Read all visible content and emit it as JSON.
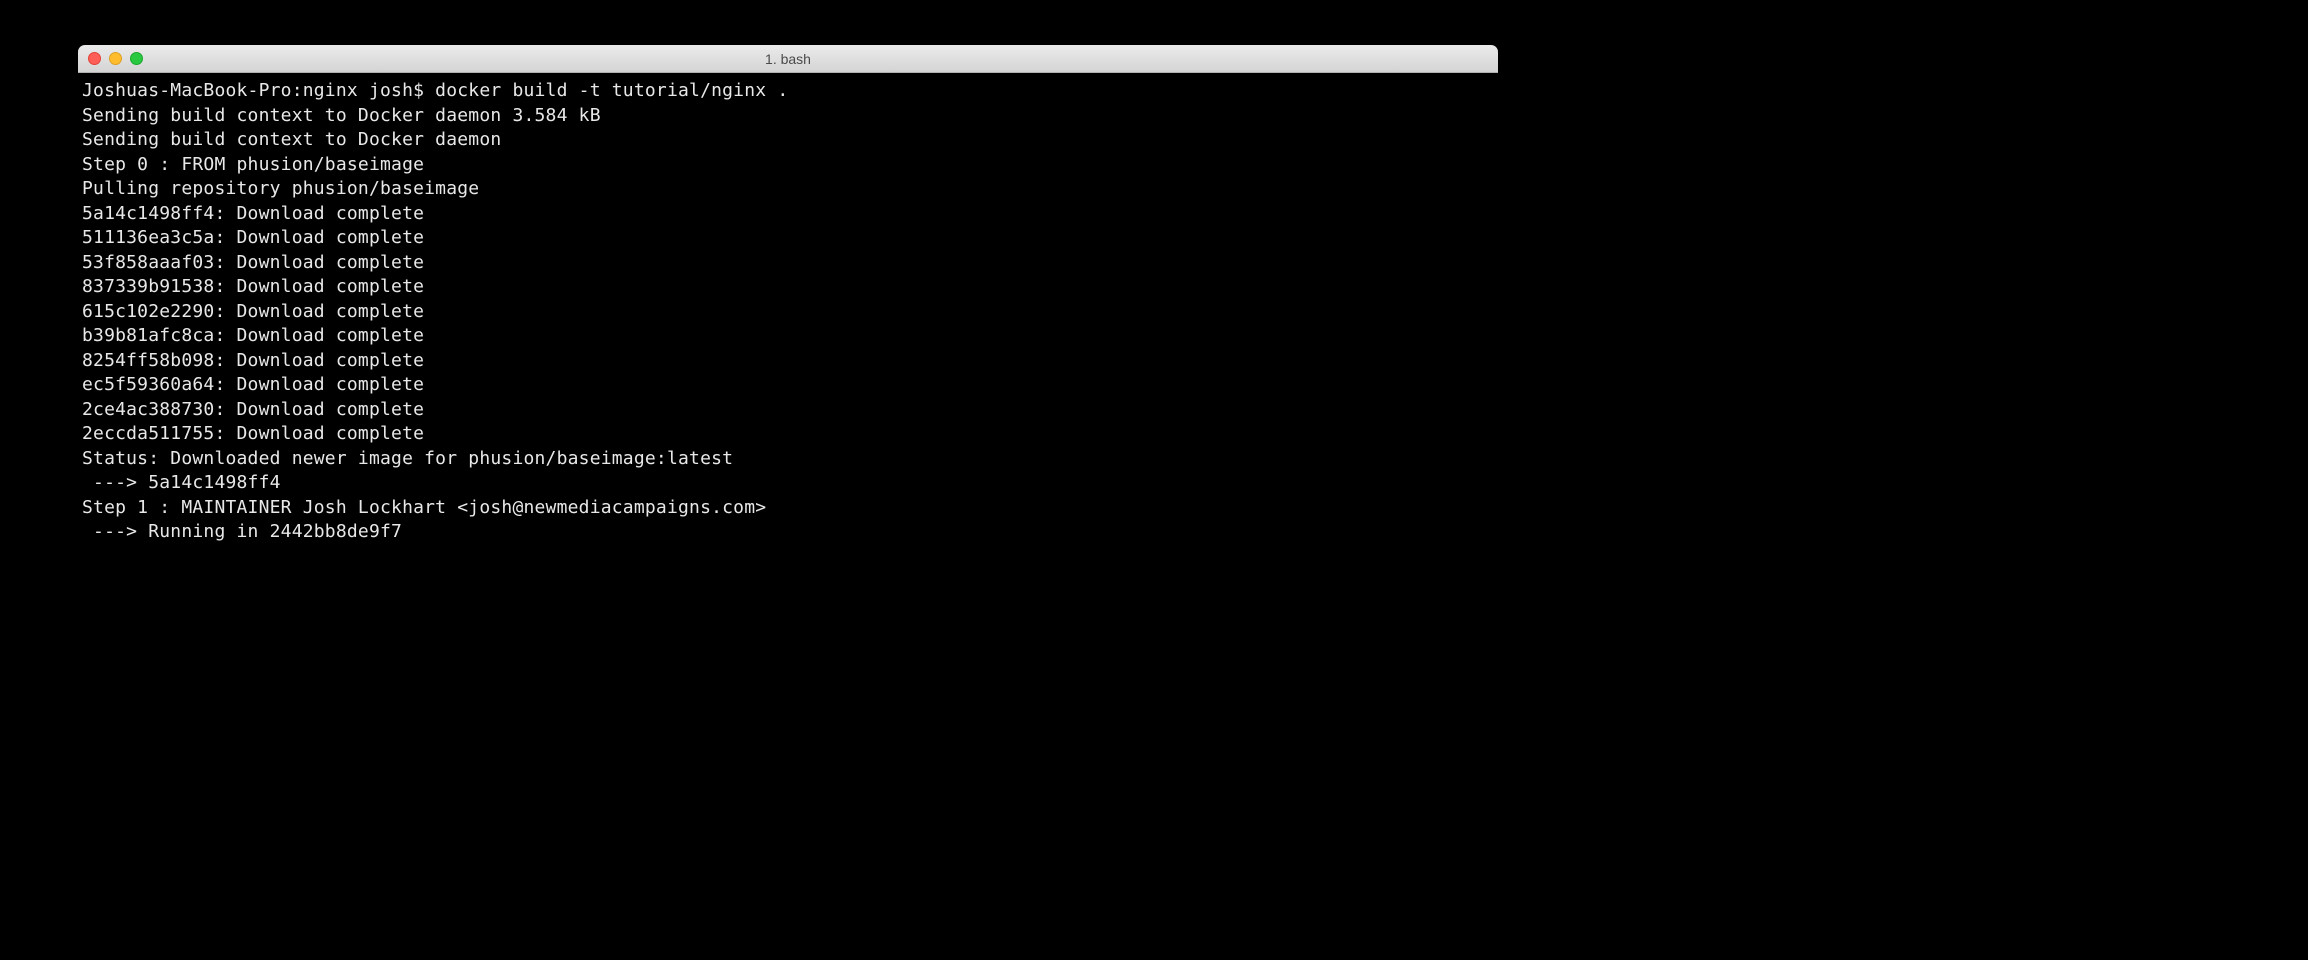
{
  "window": {
    "title": "1. bash"
  },
  "terminal": {
    "lines": [
      "Joshuas-MacBook-Pro:nginx josh$ docker build -t tutorial/nginx .",
      "Sending build context to Docker daemon 3.584 kB",
      "Sending build context to Docker daemon",
      "Step 0 : FROM phusion/baseimage",
      "Pulling repository phusion/baseimage",
      "5a14c1498ff4: Download complete",
      "511136ea3c5a: Download complete",
      "53f858aaaf03: Download complete",
      "837339b91538: Download complete",
      "615c102e2290: Download complete",
      "b39b81afc8ca: Download complete",
      "8254ff58b098: Download complete",
      "ec5f59360a64: Download complete",
      "2ce4ac388730: Download complete",
      "2eccda511755: Download complete",
      "Status: Downloaded newer image for phusion/baseimage:latest",
      " ---> 5a14c1498ff4",
      "Step 1 : MAINTAINER Josh Lockhart <josh@newmediacampaigns.com>",
      " ---> Running in 2442bb8de9f7"
    ]
  }
}
